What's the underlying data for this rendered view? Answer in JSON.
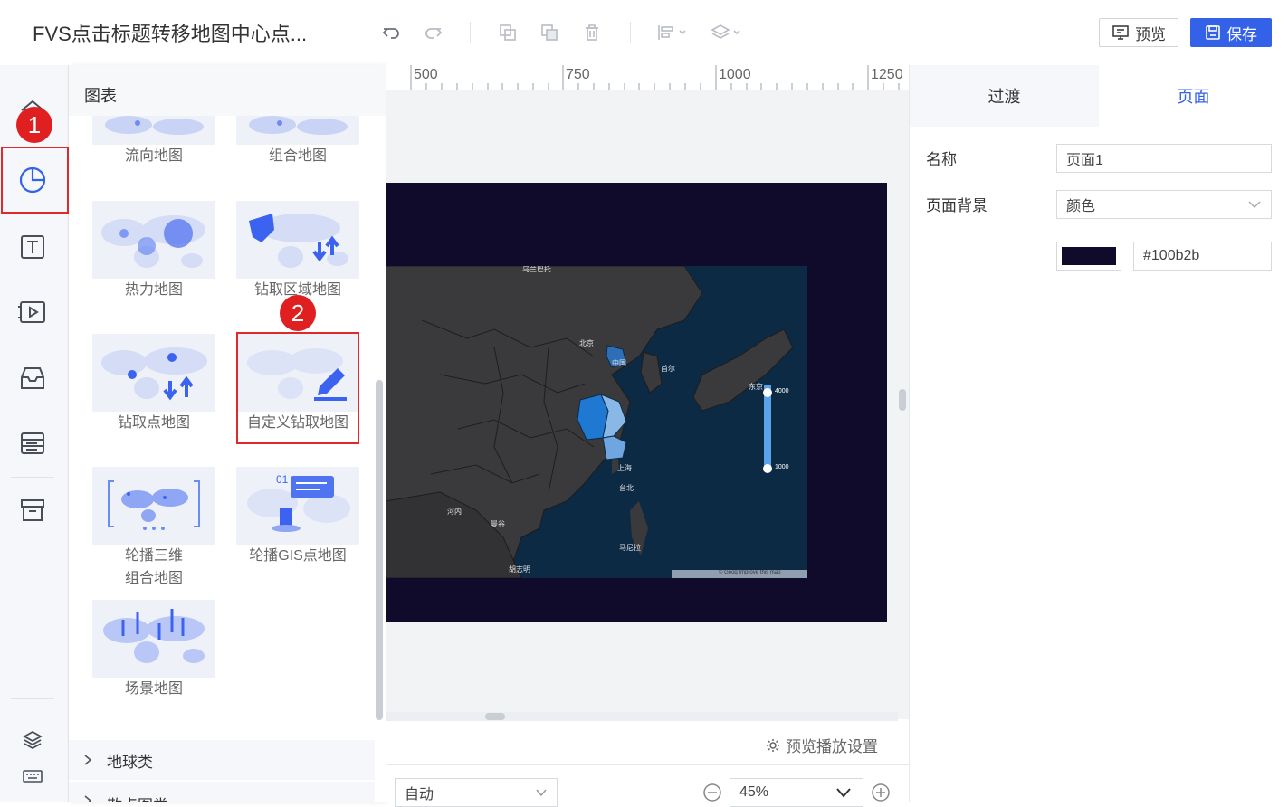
{
  "app": {
    "title": "FVS点击标题转移地图中心点..."
  },
  "toolbar": {
    "preview_label": "预览",
    "save_label": "保存"
  },
  "panel": {
    "title": "图表",
    "charts": [
      {
        "label": "流向地图"
      },
      {
        "label": "组合地图"
      },
      {
        "label": "热力地图"
      },
      {
        "label": "钻取区域地图"
      },
      {
        "label": "钻取点地图"
      },
      {
        "label": "自定义钻取地图"
      },
      {
        "label": "轮播三维"
      },
      {
        "label": "组合地图"
      },
      {
        "label": "轮播GIS点地图"
      },
      {
        "label": "场景地图"
      }
    ],
    "categories": [
      {
        "label": "地球类"
      },
      {
        "label": "散点图类"
      }
    ]
  },
  "ruler": {
    "ticks": [
      "500",
      "750",
      "1000",
      "1250"
    ]
  },
  "map": {
    "labels": [
      "乌兰巴托",
      "北京",
      "中国",
      "首尔",
      "东京",
      "上海",
      "台北",
      "河内",
      "曼谷",
      "马尼拉",
      "胡志明"
    ],
    "legend": {
      "max": "4000",
      "min": "1000"
    },
    "attribution": "© Geoq Improve this map"
  },
  "bottom": {
    "preview_settings": "预览播放设置",
    "scale_mode": "自动",
    "zoom": "45%"
  },
  "rpanel": {
    "tabs": [
      {
        "label": "过渡"
      },
      {
        "label": "页面"
      }
    ],
    "active_tab": "页面",
    "name_label": "名称",
    "name_value": "页面1",
    "bg_label": "页面背景",
    "bg_type": "颜色",
    "bg_color_hex": "#100b2b"
  },
  "annotations": [
    "1",
    "2"
  ],
  "colors": {
    "accent": "#3361e8",
    "page_bg": "#100b2b",
    "highlight": "#e02a2a"
  }
}
